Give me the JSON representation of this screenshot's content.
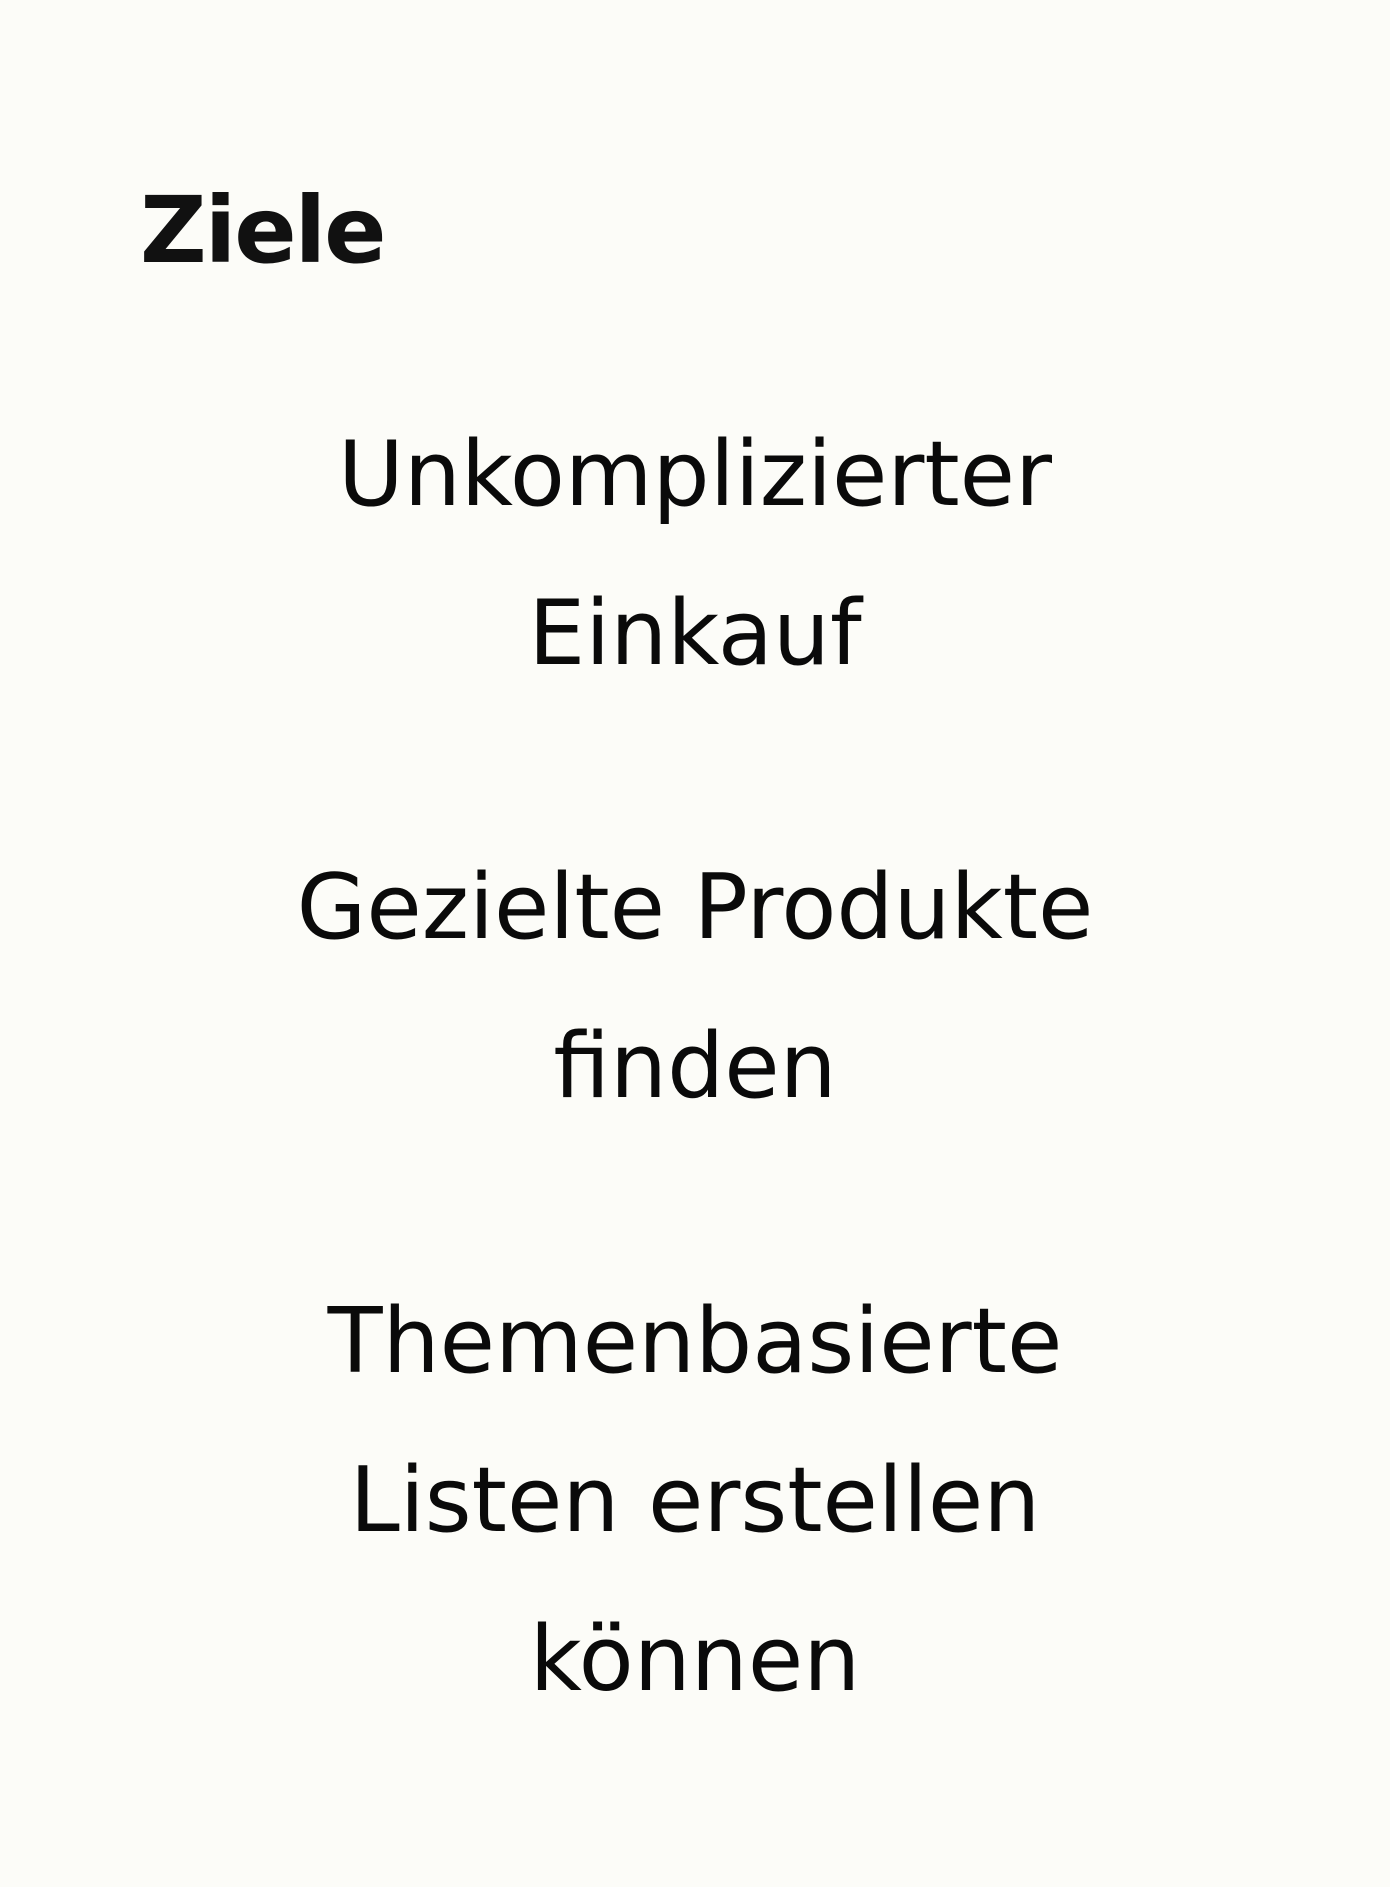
{
  "heading": "Ziele",
  "goals": [
    {
      "lines": [
        "Unkomplizierter",
        "Einkauf"
      ]
    },
    {
      "lines": [
        "Gezielte Produkte",
        "finden"
      ]
    },
    {
      "lines": [
        "Themenbasierte",
        "Listen erstellen",
        "können"
      ]
    }
  ]
}
